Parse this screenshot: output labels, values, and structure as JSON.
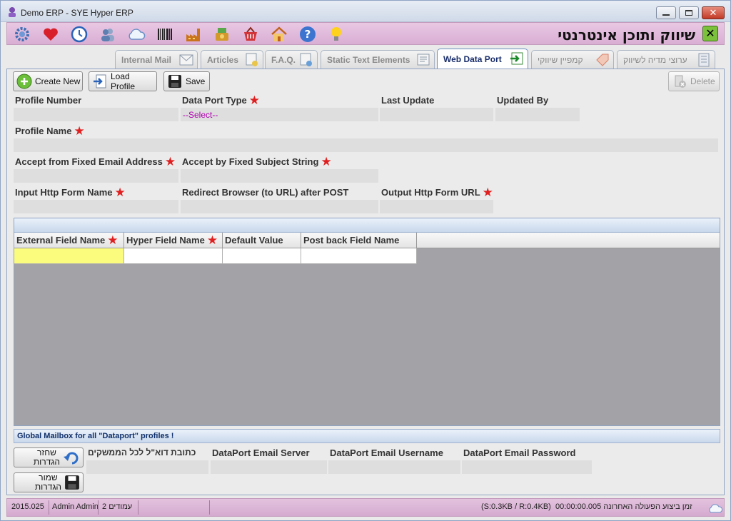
{
  "window": {
    "title": "Demo ERP - SYE Hyper ERP"
  },
  "page_title": "שיווק ותוכן אינטרנטי",
  "toolbar_icons": [
    "gear-icon",
    "heart-icon",
    "clock-icon",
    "users-icon",
    "cloud-icon",
    "barcode-icon",
    "factory-icon",
    "cash-register-icon",
    "basket-icon",
    "home-icon",
    "help-icon",
    "lightbulb-icon"
  ],
  "tabs": [
    {
      "label": "Internal Mail"
    },
    {
      "label": "Articles"
    },
    {
      "label": "F.A.Q."
    },
    {
      "label": "Static Text Elements"
    },
    {
      "label": "Web Data Port"
    },
    {
      "label": "קמפיין שיווקי"
    },
    {
      "label": "ערוצי מדיה לשיווק"
    }
  ],
  "actions": {
    "create_new": "Create New",
    "load_profile": "Load Profile",
    "save": "Save",
    "delete": "Delete"
  },
  "fields": {
    "profile_number": {
      "label": "Profile Number",
      "value": ""
    },
    "data_port_type": {
      "label": "Data Port Type",
      "value": "--Select--"
    },
    "last_update": {
      "label": "Last Update",
      "value": ""
    },
    "updated_by": {
      "label": "Updated By",
      "value": ""
    },
    "profile_name": {
      "label": "Profile Name",
      "value": ""
    },
    "accept_email": {
      "label": "Accept from Fixed Email Address",
      "value": ""
    },
    "accept_subject": {
      "label": "Accept by Fixed Subject String",
      "value": ""
    },
    "input_form": {
      "label": "Input Http Form Name",
      "value": ""
    },
    "redirect_url": {
      "label": "Redirect Browser (to URL) after POST",
      "value": ""
    },
    "output_form": {
      "label": "Output Http Form URL",
      "value": ""
    }
  },
  "grid": {
    "columns": [
      "External Field Name",
      "Hyper Field Name",
      "Default Value",
      "Post back Field Name"
    ]
  },
  "mailbox": {
    "section_title": "Global Mailbox for all \"Dataport\" profiles !",
    "restore_label_1": "שחזר",
    "restore_label_2": "הגדרות",
    "save_label_1": "שמור",
    "save_label_2": "הגדרות",
    "email_label": "כתובת דוא\"ל לכל הממשקים",
    "server_label": "DataPort Email Server",
    "username_label": "DataPort Email Username",
    "password_label": "DataPort Email Password"
  },
  "status": {
    "version": "2015.025",
    "user": "Admin Admin",
    "pages": "2 עמודים",
    "traffic": "(S:0.3KB / R:0.4KB)",
    "last_action": "00:00:00.005 זמן ביצוע הפעולה האחרונה"
  }
}
